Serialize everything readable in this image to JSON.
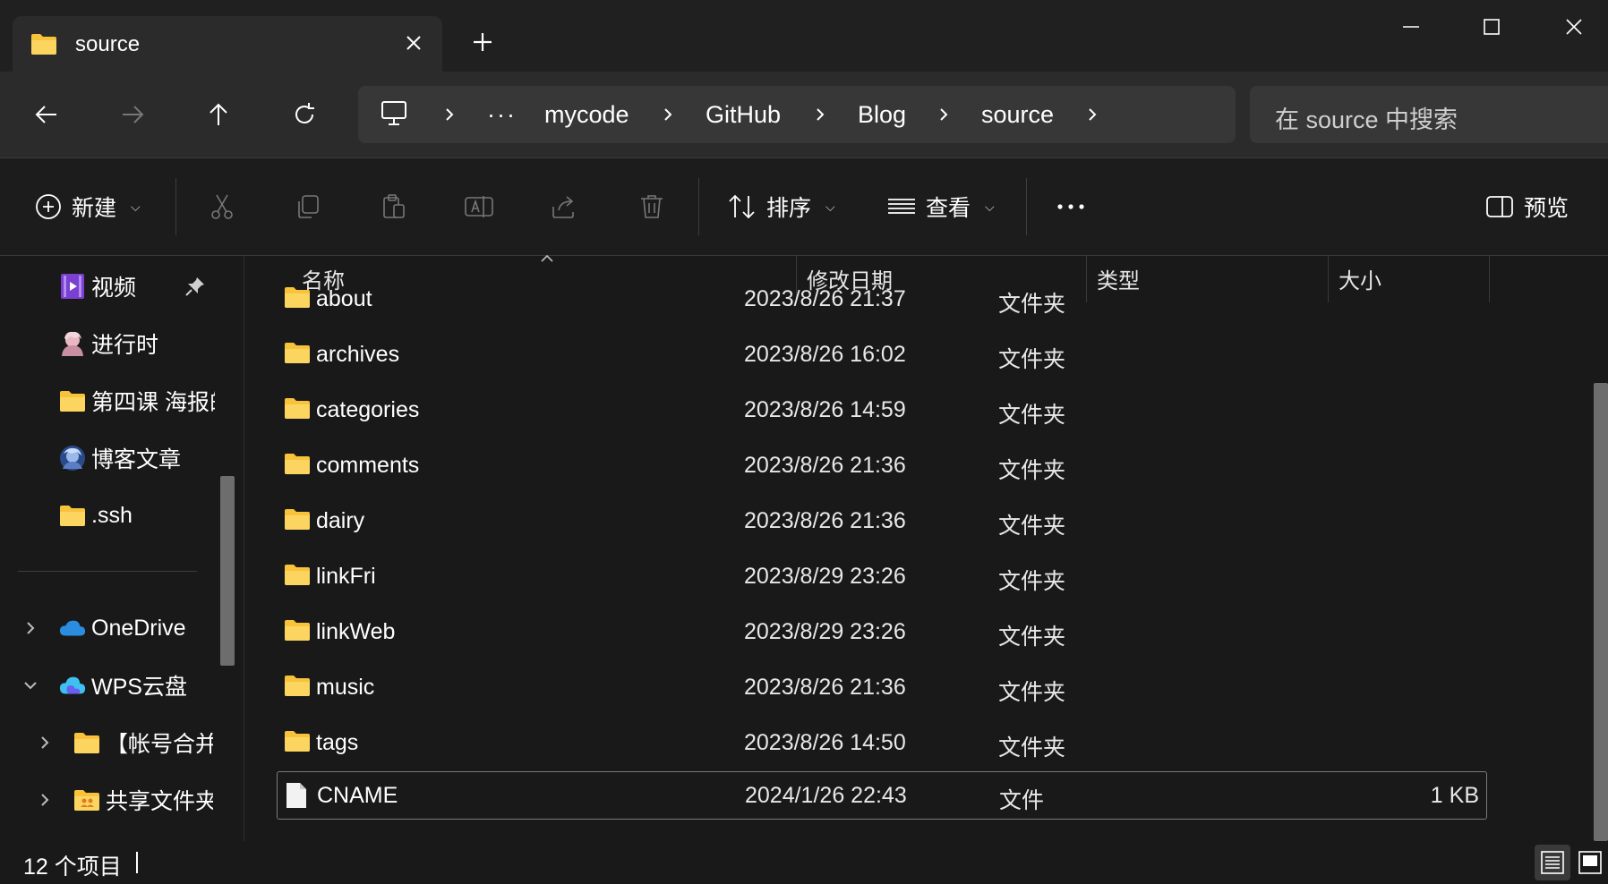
{
  "tab": {
    "title": "source"
  },
  "address": {
    "crumbs": [
      "mycode",
      "GitHub",
      "Blog",
      "source"
    ]
  },
  "search": {
    "placeholder": "在 source 中搜索"
  },
  "commands": {
    "new": "新建",
    "sort": "排序",
    "view": "查看",
    "preview": "预览"
  },
  "sidebar": {
    "items": [
      {
        "label": "视频",
        "icon": "video-folder-icon",
        "pinned": true
      },
      {
        "label": "进行时",
        "icon": "avatar-folder-icon"
      },
      {
        "label": "第四课 海报的",
        "icon": "folder-icon"
      },
      {
        "label": "博客文章",
        "icon": "avatar-folder-icon"
      },
      {
        "label": ".ssh",
        "icon": "folder-icon"
      },
      {
        "label": "OneDrive",
        "icon": "cloud-icon"
      },
      {
        "label": "WPS云盘",
        "icon": "wps-cloud-icon"
      },
      {
        "label": "【帐号合并",
        "icon": "folder-icon"
      },
      {
        "label": "共享文件夹",
        "icon": "shared-folder-icon"
      }
    ]
  },
  "columns": {
    "name": "名称",
    "modified": "修改日期",
    "type": "类型",
    "size": "大小"
  },
  "files": [
    {
      "name": "about",
      "modified": "2023/8/26 21:37",
      "type": "文件夹",
      "size": ""
    },
    {
      "name": "archives",
      "modified": "2023/8/26 16:02",
      "type": "文件夹",
      "size": ""
    },
    {
      "name": "categories",
      "modified": "2023/8/26 14:59",
      "type": "文件夹",
      "size": ""
    },
    {
      "name": "comments",
      "modified": "2023/8/26 21:36",
      "type": "文件夹",
      "size": ""
    },
    {
      "name": "dairy",
      "modified": "2023/8/26 21:36",
      "type": "文件夹",
      "size": ""
    },
    {
      "name": "linkFri",
      "modified": "2023/8/29 23:26",
      "type": "文件夹",
      "size": ""
    },
    {
      "name": "linkWeb",
      "modified": "2023/8/29 23:26",
      "type": "文件夹",
      "size": ""
    },
    {
      "name": "music",
      "modified": "2023/8/26 21:36",
      "type": "文件夹",
      "size": ""
    },
    {
      "name": "tags",
      "modified": "2023/8/26 14:50",
      "type": "文件夹",
      "size": ""
    },
    {
      "name": "CNAME",
      "modified": "2024/1/26 22:43",
      "type": "文件",
      "size": "1 KB"
    }
  ],
  "status": {
    "count": "12 个项目"
  },
  "colors": {
    "folder": "#f8c33a",
    "background": "#191919",
    "titlebar": "#202020",
    "navbar": "#2b2b2b"
  }
}
